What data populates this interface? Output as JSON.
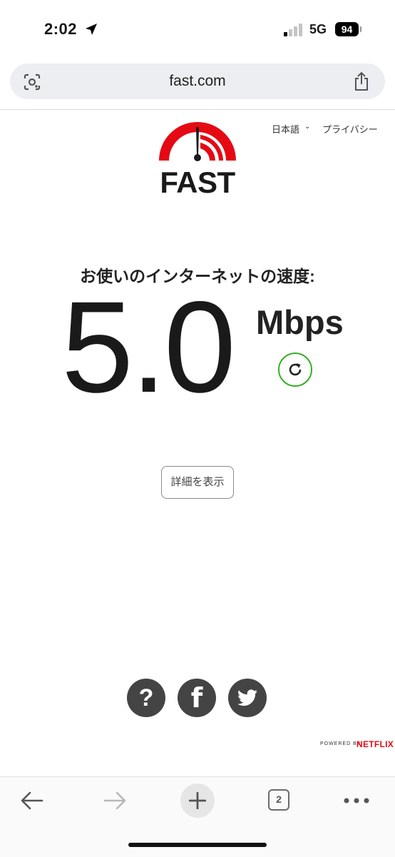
{
  "status_bar": {
    "time": "2:02",
    "network": "5G",
    "battery": "94"
  },
  "browser": {
    "url": "fast.com",
    "tab_count": "2"
  },
  "header": {
    "language": "日本語",
    "privacy": "プライバシー"
  },
  "logo": {
    "text": "FAST",
    "colors": {
      "arc": "#e50914",
      "needle": "#1a1a1a"
    }
  },
  "speed": {
    "label": "お使いのインターネットの速度:",
    "value": "5.0",
    "unit": "Mbps"
  },
  "details_button": "詳細を表示",
  "social": {
    "help_label": "?",
    "facebook_label": "f"
  },
  "footer": {
    "powered_by": "POWERED BY",
    "brand": "NETFLIX"
  },
  "accent_colors": {
    "refresh_ring": "#3dae2b",
    "netflix_red": "#e50914"
  }
}
